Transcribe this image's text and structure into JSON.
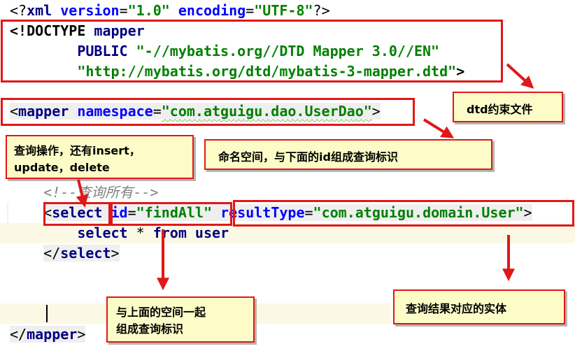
{
  "code": {
    "line1": {
      "a": "<?",
      "b": "xml",
      "c": " ",
      "d": "version",
      "e": "=",
      "f": "\"1.0\"",
      "g": " ",
      "h": "encoding",
      "i": "=",
      "j": "\"UTF-8\"",
      "k": "?>"
    },
    "line2": {
      "a": "<!DOCTYPE ",
      "b": "mapper"
    },
    "line3": {
      "indent": "        ",
      "a": "PUBLIC ",
      "b": "\"-//mybatis.org//DTD Mapper 3.0//EN\""
    },
    "line4": {
      "indent": "        ",
      "a": "\"http://mybatis.org/dtd/mybatis-3-mapper.dtd\"",
      "b": ">"
    },
    "line5": {
      "a": "<",
      "b": "mapper",
      "c": " ",
      "d": "namespace",
      "e": "=",
      "f": "\"com.atguigu.dao.UserDao\"",
      "g": ">"
    },
    "line6": {
      "indent": "    ",
      "a": "<!--查询所有-->"
    },
    "line7": {
      "indent": "    ",
      "a": "<",
      "b": "select",
      "c": " ",
      "d": "id",
      "e": "=",
      "f": "\"findAll\"",
      "g": " ",
      "h": "resultType",
      "i": "=",
      "j": "\"com.atguigu.domain.User\"",
      "k": ">"
    },
    "line8": {
      "indent": "        ",
      "a": "select",
      "b": " * ",
      "c": "from",
      "d": " ",
      "e": "user"
    },
    "line9": {
      "indent": "    ",
      "a": "</",
      "b": "select",
      "c": ">"
    },
    "line10": {
      "a": "</",
      "b": "mapper",
      "c": ">"
    }
  },
  "notes": {
    "dtd": "dtd约束文件",
    "namespace": "命名空间，与下面的id组成查询标识",
    "ops_line1": "查询操作，还有insert，",
    "ops_line2": "update，delete",
    "id_line1": "与上面的空间一起",
    "id_line2": "组成查询标识",
    "result": "查询结果对应的实体"
  },
  "colors": {
    "annotation_red": "#e01818",
    "note_bg": "#fdfcc8",
    "tag": "#000080",
    "attr": "#0000ff",
    "string": "#008000",
    "comment": "#808080",
    "current_line": "#fbf9e6"
  }
}
